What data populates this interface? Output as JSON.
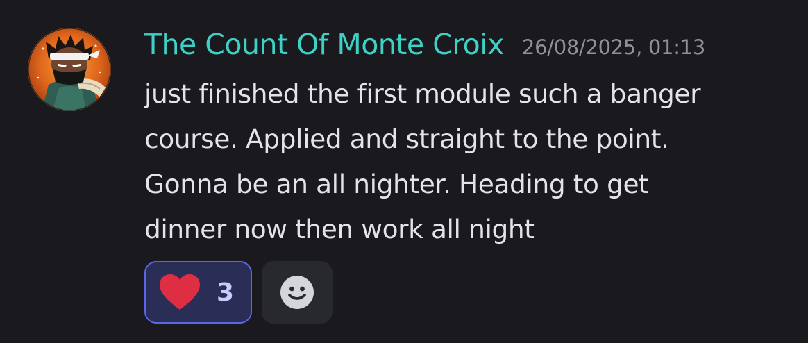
{
  "message": {
    "author": "The Count Of Monte Croix",
    "timestamp": "26/08/2025, 01:13",
    "lines": [
      "just finished the first module such a banger",
      "course. Applied and straight to the point.",
      "Gonna be an all nighter. Heading to get",
      "dinner now then work all night"
    ],
    "avatar_icon": "ninja-avatar",
    "colors": {
      "author": "#3fd1c7",
      "timestamp": "#8e9199",
      "text": "#e3e4e8",
      "background": "#1a1a1e",
      "reaction_active_border": "#5b65ea",
      "reaction_active_bg": "#2a2e56",
      "heart": "#dd2e44"
    }
  },
  "reactions": [
    {
      "emoji": "heart",
      "count": "3",
      "active": true
    }
  ],
  "add_reaction": {
    "icon": "smiley-icon"
  }
}
